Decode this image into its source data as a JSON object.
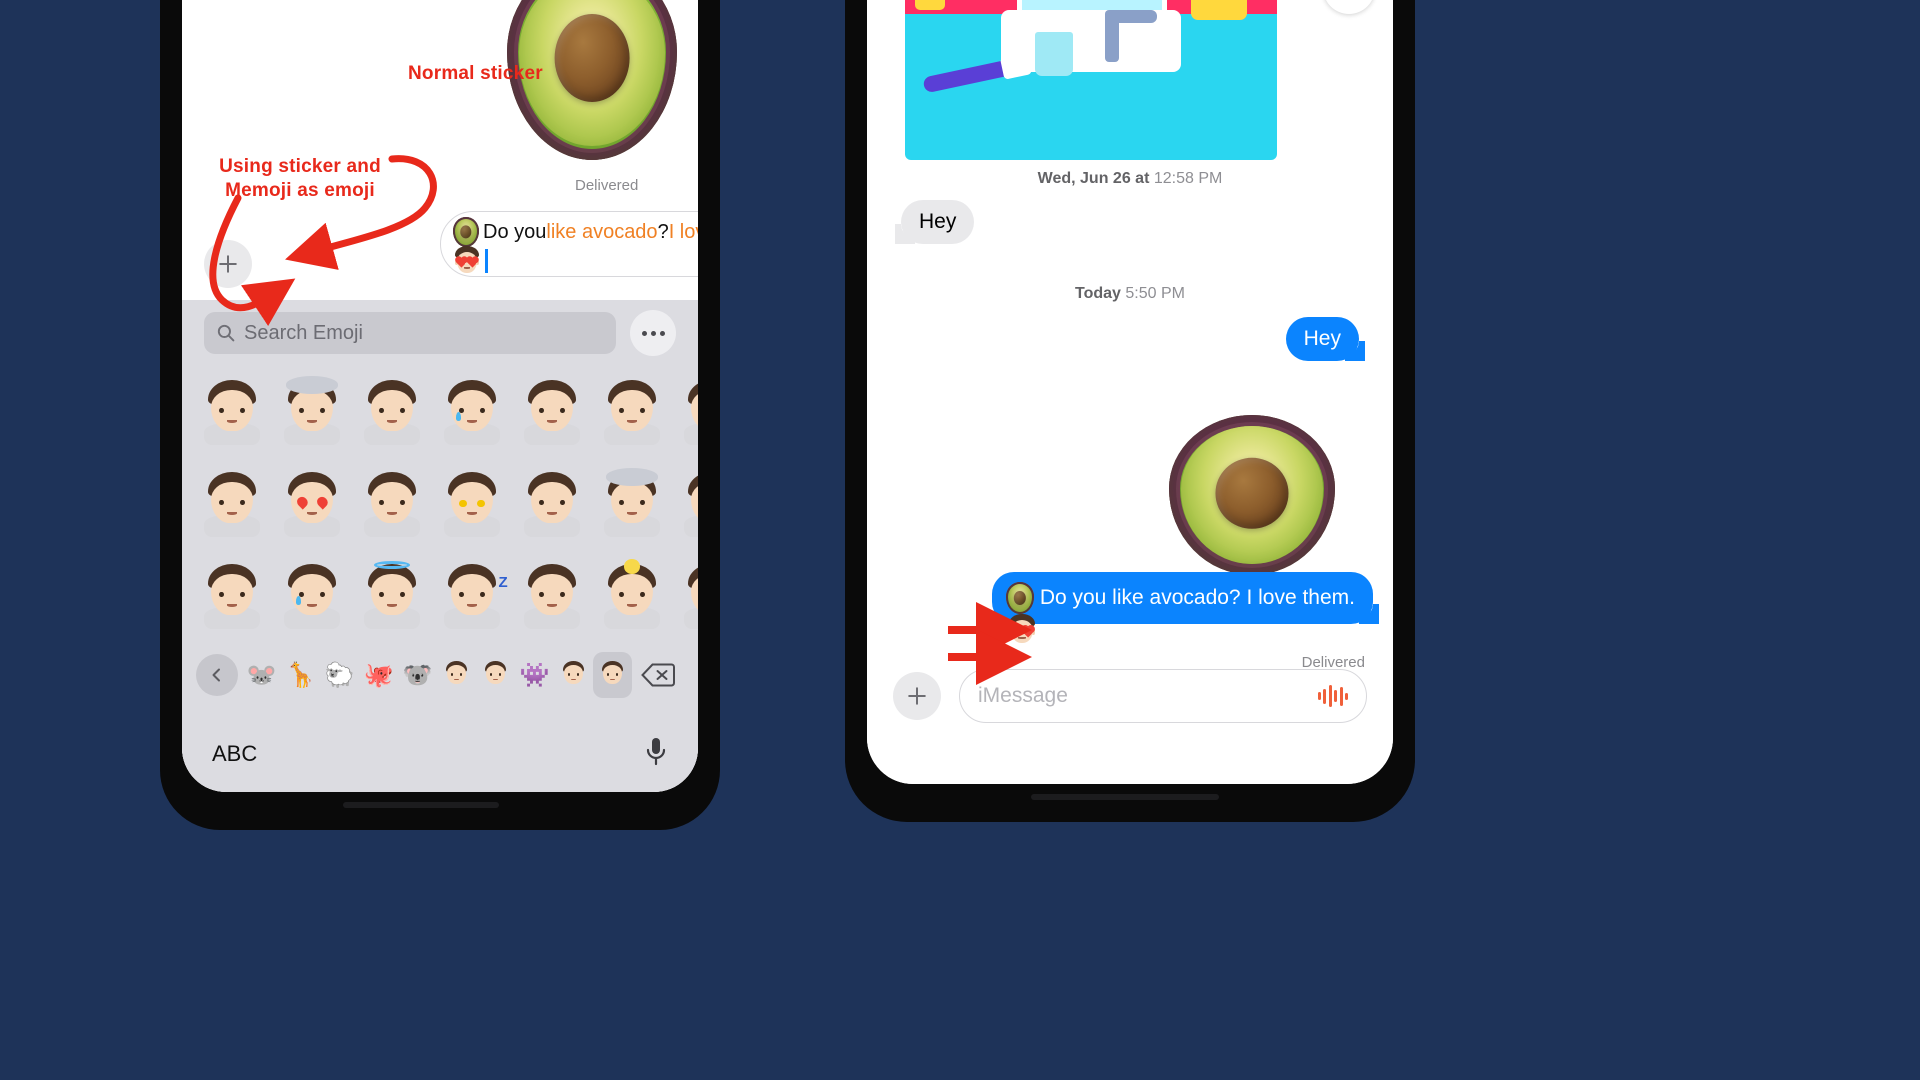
{
  "scene": {
    "background_color": "#1e3359",
    "annotation_color": "#e8291b"
  },
  "annotations": [
    {
      "id": "normal-sticker",
      "text": "Normal sticker"
    },
    {
      "id": "sticker-memoji",
      "text": "Using sticker and\nMemoji as emoji"
    }
  ],
  "left_phone": {
    "compose": {
      "message_line1_part1": "Do you ",
      "message_line1_part2": "like avocado",
      "message_line1_part3": "? ",
      "message_line1_part4": "I love them",
      "message_line1_part5": ".",
      "status_label": "Delivered",
      "plus_icon": "plus-icon",
      "send_icon": "send-arrow-up-icon",
      "inline_sticker_1": "avocado-sticker",
      "inline_sticker_2": "memoji-heart-eyes-sticker",
      "caret_color": "#0a84ff"
    },
    "keyboard": {
      "search_placeholder": "Search Emoji",
      "search_icon": "search-icon",
      "more_button": "more-options-icon",
      "abc_key_label": "ABC",
      "mic_icon": "microphone-icon",
      "backspace_icon": "backspace-icon",
      "prev_page_icon": "chevron-left-icon",
      "rows": [
        [
          "memoji-waving",
          "memoji-mind-blown",
          "memoji-neutral",
          "memoji-sad-tear",
          "memoji-shushing",
          "memoji-sneezing",
          "memoji-partial"
        ],
        [
          "memoji-pleading",
          "memoji-heart-eyes",
          "memoji-covering-face",
          "memoji-star-eyes",
          "memoji-raised-hand",
          "memoji-cloud-head",
          "memoji-partial"
        ],
        [
          "memoji-thumbs-up",
          "memoji-laughing-tears",
          "memoji-halo",
          "memoji-sleeping",
          "memoji-peace-sign",
          "memoji-idea-bulb",
          "memoji-partial"
        ]
      ],
      "categories": [
        "mouse-icon",
        "giraffe-icon",
        "sheep-icon",
        "octopus-icon",
        "koala-icon",
        "memoji-face-1",
        "memoji-face-2",
        "alien-icon",
        "memoji-face-3",
        "memoji-face-4"
      ],
      "selected_category_index": 9
    }
  },
  "right_phone": {
    "messages": [
      {
        "type": "sticker",
        "name": "panda-brushing-teeth-sticker",
        "side": "incoming"
      },
      {
        "type": "timestamp",
        "prefix": "Wed, Jun 26 at",
        "time": "12:58 PM"
      },
      {
        "type": "bubble",
        "side": "incoming",
        "text": "Hey"
      },
      {
        "type": "timestamp",
        "prefix": "Today",
        "time": "5:50 PM"
      },
      {
        "type": "bubble",
        "side": "outgoing",
        "text": "Hey"
      },
      {
        "type": "sticker",
        "name": "avocado-sticker",
        "side": "outgoing"
      },
      {
        "type": "bubble",
        "side": "outgoing",
        "text": "Do you like avocado? I love them.",
        "has_stickers": true
      }
    ],
    "delivered_label": "Delivered",
    "download_icon": "download-sticker-icon",
    "input": {
      "placeholder": "iMessage",
      "plus_icon": "plus-icon",
      "audio_icon": "audio-message-icon"
    },
    "bubble_blue": "#0b84fe",
    "bubble_gray": "#e9e9eb"
  }
}
